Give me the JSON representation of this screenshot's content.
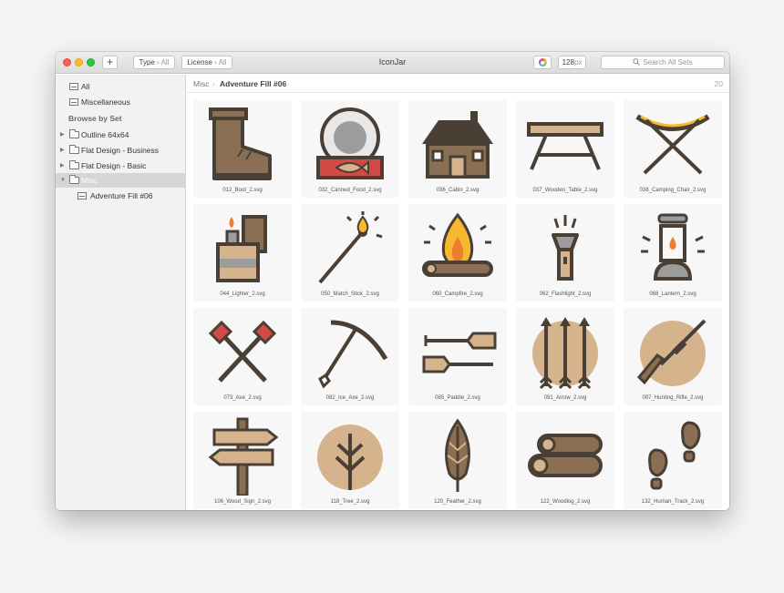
{
  "window": {
    "title": "IconJar",
    "add_label": "+",
    "type_filter": {
      "label": "Type",
      "value": "All"
    },
    "license_filter": {
      "label": "License",
      "value": "All"
    },
    "size_value": "128",
    "size_unit": "px",
    "search_placeholder": "Search All Sets"
  },
  "sidebar": {
    "all": "All",
    "miscellaneous": "Miscellaneous",
    "browse_heading": "Browse by Set",
    "sets": [
      {
        "label": "Outline 64x64"
      },
      {
        "label": "Flat Design - Business"
      },
      {
        "label": "Flat Design - Basic"
      },
      {
        "label": "Misc"
      }
    ],
    "subset": "Adventure Fill #06"
  },
  "breadcrumb": {
    "root": "Misc",
    "separator": "›",
    "current": "Adventure Fill #06",
    "count": "20"
  },
  "icons": [
    {
      "file": "012_Boot_2.svg",
      "icon": "boot-icon"
    },
    {
      "file": "032_Canned_Food_2.svg",
      "icon": "canned-food-icon"
    },
    {
      "file": "036_Cabin_2.svg",
      "icon": "cabin-icon"
    },
    {
      "file": "037_Wooden_Table_2.svg",
      "icon": "wooden-table-icon"
    },
    {
      "file": "038_Camping_Chair_2.svg",
      "icon": "camping-chair-icon"
    },
    {
      "file": "044_Lighter_2.svg",
      "icon": "lighter-icon"
    },
    {
      "file": "050_Match_Stick_2.svg",
      "icon": "match-stick-icon"
    },
    {
      "file": "060_Campfire_2.svg",
      "icon": "campfire-icon"
    },
    {
      "file": "062_Flashlight_2.svg",
      "icon": "flashlight-icon"
    },
    {
      "file": "068_Lantern_2.svg",
      "icon": "lantern-icon"
    },
    {
      "file": "073_Axe_2.svg",
      "icon": "axe-icon"
    },
    {
      "file": "082_Ice_Axe_2.svg",
      "icon": "ice-axe-icon"
    },
    {
      "file": "085_Paddle_2.svg",
      "icon": "paddle-icon"
    },
    {
      "file": "091_Arrow_2.svg",
      "icon": "arrow-icon"
    },
    {
      "file": "097_Hunting_Rifle_2.svg",
      "icon": "hunting-rifle-icon"
    },
    {
      "file": "106_Wood_Sign_2.svg",
      "icon": "wood-sign-icon"
    },
    {
      "file": "118_Tree_2.svg",
      "icon": "tree-icon"
    },
    {
      "file": "120_Feather_2.svg",
      "icon": "feather-icon"
    },
    {
      "file": "122_Woodlog_2.svg",
      "icon": "woodlog-icon"
    },
    {
      "file": "132_Human_Track_2.svg",
      "icon": "human-track-icon"
    }
  ],
  "colors": {
    "outline": "#4a3f35",
    "wood": "#8b6f55",
    "tan": "#d5b48d",
    "red": "#d34a45",
    "flame_yellow": "#f5b82e",
    "flame_orange": "#ee7d2e",
    "grey": "#9c9c9c"
  }
}
